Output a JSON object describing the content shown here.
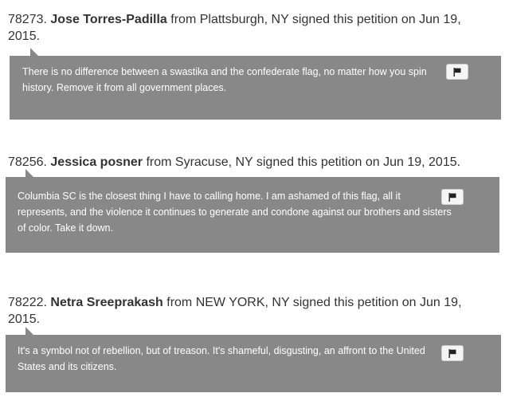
{
  "signatures": [
    {
      "number": "78273.",
      "name": "Jose Torres-Padilla",
      "details": " from Plattsburgh, NY signed this petition on Jun 19, 2015.",
      "comment": "There is no difference between a swastika and the confederate flag, no matter how you spin history. Remove it from all government places.",
      "flag_icon": "flag-icon"
    },
    {
      "number": "78256.",
      "name": "Jessica posner",
      "details": " from Syracuse, NY signed this petition on Jun 19, 2015.",
      "comment": "Columbia SC is the closest thing I have to calling home. I am ashamed of this flag, all it represents, and the violence it continues to generate and condone against our brothers and sisters of color. Take it down.",
      "flag_icon": "flag-icon"
    },
    {
      "number": "78222.",
      "name": "Netra Sreeprakash",
      "details": " from NEW YORK, NY signed this petition on Jun 19, 2015.",
      "comment": "It's a symbol not of rebellion, but of treason. It's shameful, disgusting, an affront to the United States and its citizens.",
      "flag_icon": "flag-icon"
    }
  ],
  "colors": {
    "bubble_background": "#888888",
    "text": "#333333",
    "bubble_text": "#ffffff"
  }
}
